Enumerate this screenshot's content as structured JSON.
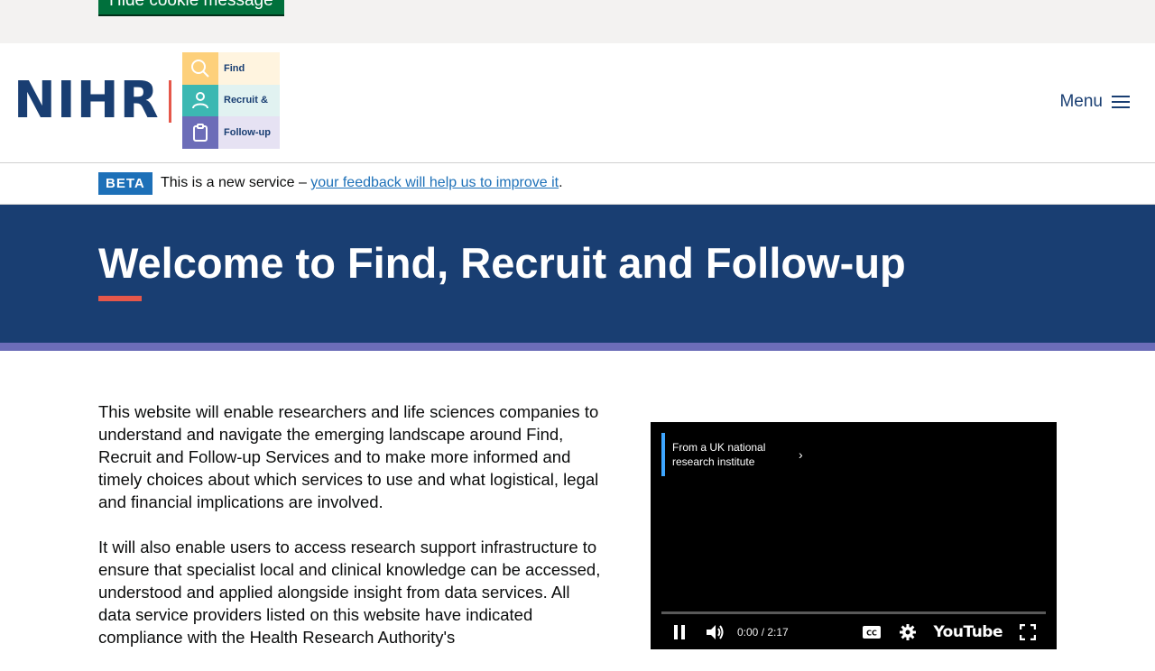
{
  "cookie": {
    "hide_label": "Hide cookie message"
  },
  "header": {
    "logo_text": "NIHR",
    "frf_items": [
      {
        "label": "Find",
        "icon": "search-icon",
        "color": "#fdd07b",
        "bg": "#fff4df"
      },
      {
        "label": "Recruit &",
        "icon": "person-icon",
        "color": "#3cb8b2",
        "bg": "#e1f2f1"
      },
      {
        "label": "Follow-up",
        "icon": "clipboard-icon",
        "color": "#6c6db8",
        "bg": "#e6e2f3"
      }
    ],
    "menu_label": "Menu"
  },
  "beta": {
    "tag": "BETA",
    "text_before": "This is a new service – ",
    "link_text": "your feedback will help us to improve it",
    "text_after": "."
  },
  "hero": {
    "title": "Welcome to Find, Recruit and Follow-up"
  },
  "content": {
    "paragraphs": [
      "This website will enable researchers and life sciences companies to understand and navigate the emerging landscape around Find, Recruit and Follow-up Services and to make more informed and timely choices about which services to use and what logistical, legal and financial implications are involved.",
      "It will also enable users to access research support infrastructure to ensure that specialist local and clinical knowledge can be accessed, understood and applied alongside insight from data services. All data service providers listed on this website have indicated compliance with the Health Research Authority's"
    ]
  },
  "video": {
    "title": "From a UK national research institute",
    "time": "0:00 / 2:17",
    "brand": "YouTube"
  },
  "colors": {
    "navy": "#193e72",
    "accent_red": "#e5574a",
    "purple": "#6c6db8",
    "link_blue": "#1d70b8",
    "green": "#00703c"
  }
}
